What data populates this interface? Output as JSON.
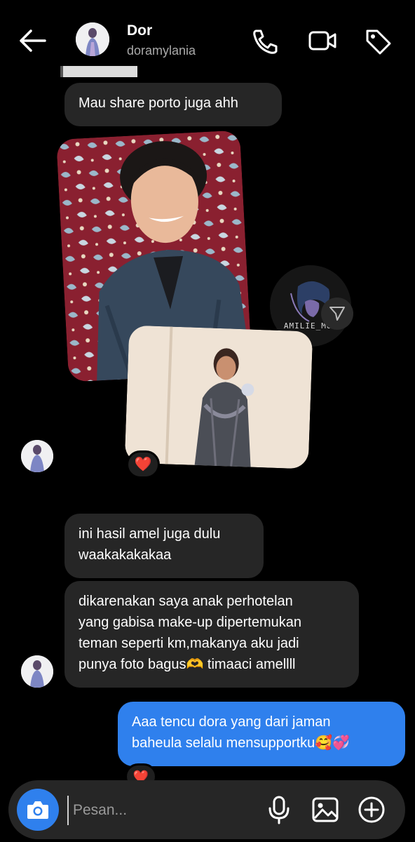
{
  "header": {
    "name": "Dor",
    "username": "doramylania"
  },
  "messages": {
    "m1": "Mau share porto juga ahh",
    "m2_line1": "ini hasil amel juga dulu",
    "m2_line2": "waakakakakaa",
    "m3_line1": "dikarenakan saya anak perhotelan",
    "m3_line2": "yang gabisa make-up dipertemukan",
    "m3_line3": "teman seperti km,makanya aku jadi",
    "m3_line4": "punya foto bagus🫶 timaaci amellll",
    "m4_line1": "Aaa tencu dora yang dari jaman",
    "m4_line2": "baheula selalu mensupportku🥰💞"
  },
  "watermark": "AMILIE_MUA",
  "composer": {
    "placeholder": "Pesan..."
  },
  "reactions": {
    "photo_reaction": "❤️",
    "reply_reaction": "❤️"
  },
  "colors": {
    "background": "#000000",
    "bubble_them": "#262626",
    "bubble_me": "#2f80ed",
    "accent": "#2f80ed"
  }
}
